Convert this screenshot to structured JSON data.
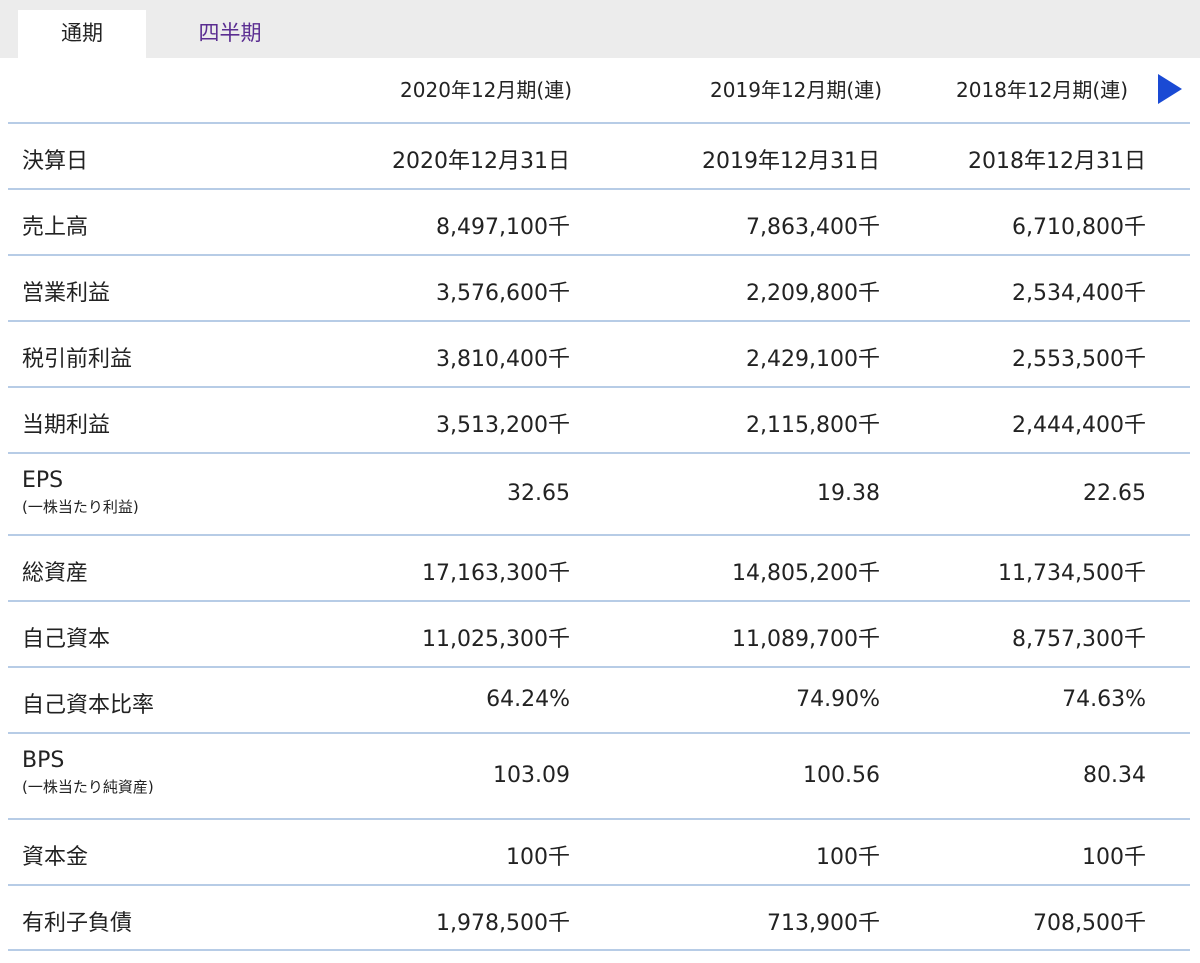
{
  "tabs": [
    {
      "label": "通期",
      "active": true
    },
    {
      "label": "四半期",
      "active": false
    }
  ],
  "columns": [
    "2020年12月期(連)",
    "2019年12月期(連)",
    "2018年12月期(連)"
  ],
  "next_icon": "play-right-icon",
  "rows": [
    {
      "label": "決算日",
      "values": [
        "2020年12月31日",
        "2019年12月31日",
        "2018年12月31日"
      ]
    },
    {
      "label": "売上高",
      "values": [
        "8,497,100千",
        "7,863,400千",
        "6,710,800千"
      ]
    },
    {
      "label": "営業利益",
      "values": [
        "3,576,600千",
        "2,209,800千",
        "2,534,400千"
      ]
    },
    {
      "label": "税引前利益",
      "values": [
        "3,810,400千",
        "2,429,100千",
        "2,553,500千"
      ]
    },
    {
      "label": "当期利益",
      "values": [
        "3,513,200千",
        "2,115,800千",
        "2,444,400千"
      ]
    },
    {
      "label": "EPS",
      "sublabel": "(一株当たり利益)",
      "values": [
        "32.65",
        "19.38",
        "22.65"
      ]
    },
    {
      "label": "総資産",
      "values": [
        "17,163,300千",
        "14,805,200千",
        "11,734,500千"
      ]
    },
    {
      "label": "自己資本",
      "values": [
        "11,025,300千",
        "11,089,700千",
        "8,757,300千"
      ]
    },
    {
      "label": "自己資本比率",
      "values": [
        "64.24%",
        "74.90%",
        "74.63%"
      ]
    },
    {
      "label": "BPS",
      "sublabel": "(一株当たり純資産)",
      "values": [
        "103.09",
        "100.56",
        "80.34"
      ]
    },
    {
      "label": "資本金",
      "values": [
        "100千",
        "100千",
        "100千"
      ]
    },
    {
      "label": "有利子負債",
      "values": [
        "1,978,500千",
        "713,900千",
        "708,500千"
      ]
    }
  ],
  "colors": {
    "tab_inactive": "#5a2d91",
    "arrow": "#1a4ad4",
    "row_border": "#b7cce6",
    "tabbar_bg": "#ececec"
  }
}
